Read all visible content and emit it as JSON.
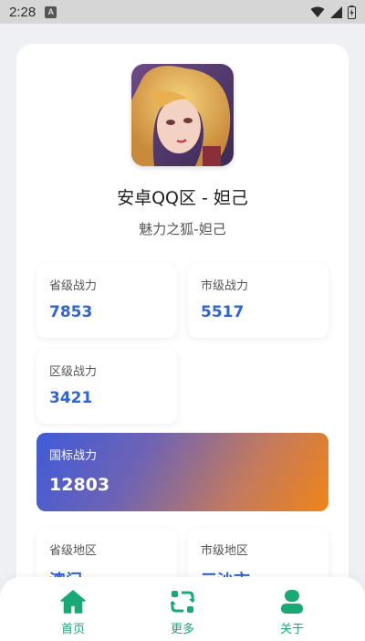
{
  "status_bar": {
    "time": "2:28",
    "notification_icon": "a-box-icon",
    "icons": [
      "wifi-icon",
      "signal-icon",
      "battery-icon"
    ]
  },
  "hero": {
    "name": "安卓QQ区 - 妲己",
    "title": "魅力之狐-妲己",
    "avatar_icon": "hero-portrait"
  },
  "stats": {
    "province": {
      "label": "省级战力",
      "value": "7853"
    },
    "city": {
      "label": "市级战力",
      "value": "5517"
    },
    "district": {
      "label": "区级战力",
      "value": "3421"
    },
    "national": {
      "label": "国标战力",
      "value": "12803"
    }
  },
  "regions": {
    "province": {
      "label": "省级地区",
      "value": "澳门"
    },
    "city": {
      "label": "市级地区",
      "value": "三沙市"
    }
  },
  "nav": {
    "items": [
      {
        "label": "首页",
        "icon": "home-icon"
      },
      {
        "label": "更多",
        "icon": "refresh-icon"
      },
      {
        "label": "关于",
        "icon": "user-icon"
      }
    ],
    "accent": "#19a974"
  },
  "colors": {
    "value_blue": "#2f63d8",
    "gradient_start": "#3f5bd8",
    "gradient_end": "#f08418"
  }
}
